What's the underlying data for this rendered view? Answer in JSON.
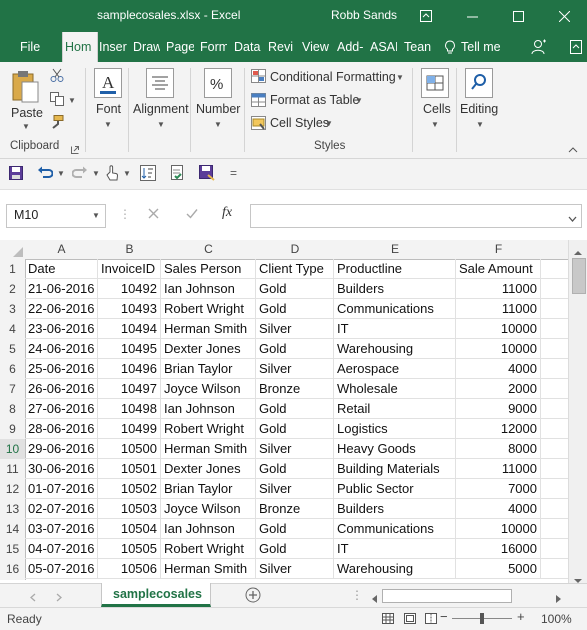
{
  "window": {
    "title": "samplecosales.xlsx  -  Excel",
    "user": "Robb Sands"
  },
  "tabs": [
    "File",
    "Hom",
    "Inser",
    "Draw",
    "Page",
    "Form",
    "Data",
    "Revi",
    "View",
    "Add-",
    "ASAI",
    "Tean"
  ],
  "tell_me": "Tell me",
  "ribbon": {
    "clipboard": {
      "paste": "Paste",
      "group": "Clipboard"
    },
    "font": "Font",
    "alignment": "Alignment",
    "number": "Number",
    "styles": {
      "conditional": "Conditional Formatting",
      "format_table": "Format as Table",
      "cell_styles": "Cell Styles",
      "group": "Styles"
    },
    "cells": "Cells",
    "editing": "Editing"
  },
  "formula_bar": {
    "name_box": "M10",
    "fx": "fx",
    "content": ""
  },
  "columns": [
    "A",
    "B",
    "C",
    "D",
    "E",
    "F"
  ],
  "headers": [
    "Date",
    "InvoiceID",
    "Sales Person",
    "Client Type",
    "Productline",
    "Sale Amount"
  ],
  "rows": [
    [
      "21-06-2016",
      "10492",
      "Ian Johnson",
      "Gold",
      "Builders",
      "11000"
    ],
    [
      "22-06-2016",
      "10493",
      "Robert Wright",
      "Gold",
      "Communications",
      "11000"
    ],
    [
      "23-06-2016",
      "10494",
      "Herman Smith",
      "Silver",
      "IT",
      "10000"
    ],
    [
      "24-06-2016",
      "10495",
      "Dexter Jones",
      "Gold",
      "Warehousing",
      "10000"
    ],
    [
      "25-06-2016",
      "10496",
      "Brian Taylor",
      "Silver",
      "Aerospace",
      "4000"
    ],
    [
      "26-06-2016",
      "10497",
      "Joyce Wilson",
      "Bronze",
      "Wholesale",
      "2000"
    ],
    [
      "27-06-2016",
      "10498",
      "Ian Johnson",
      "Gold",
      "Retail",
      "9000"
    ],
    [
      "28-06-2016",
      "10499",
      "Robert Wright",
      "Gold",
      "Logistics",
      "12000"
    ],
    [
      "29-06-2016",
      "10500",
      "Herman Smith",
      "Silver",
      "Heavy Goods",
      "8000"
    ],
    [
      "30-06-2016",
      "10501",
      "Dexter Jones",
      "Gold",
      "Building Materials",
      "11000"
    ],
    [
      "01-07-2016",
      "10502",
      "Brian Taylor",
      "Silver",
      "Public Sector",
      "7000"
    ],
    [
      "02-07-2016",
      "10503",
      "Joyce Wilson",
      "Bronze",
      "Builders",
      "4000"
    ],
    [
      "03-07-2016",
      "10504",
      "Ian Johnson",
      "Gold",
      "Communications",
      "10000"
    ],
    [
      "04-07-2016",
      "10505",
      "Robert Wright",
      "Gold",
      "IT",
      "16000"
    ],
    [
      "05-07-2016",
      "10506",
      "Herman Smith",
      "Silver",
      "Warehousing",
      "5000"
    ]
  ],
  "row_numbers": [
    "1",
    "2",
    "3",
    "4",
    "5",
    "6",
    "7",
    "8",
    "9",
    "10",
    "11",
    "12",
    "13",
    "14",
    "15",
    "16"
  ],
  "sheet_tab": "samplecosales",
  "status": {
    "ready": "Ready",
    "zoom": "100%"
  },
  "colors": {
    "accent": "#217346",
    "selected_row_header": "#e1e1e1"
  }
}
